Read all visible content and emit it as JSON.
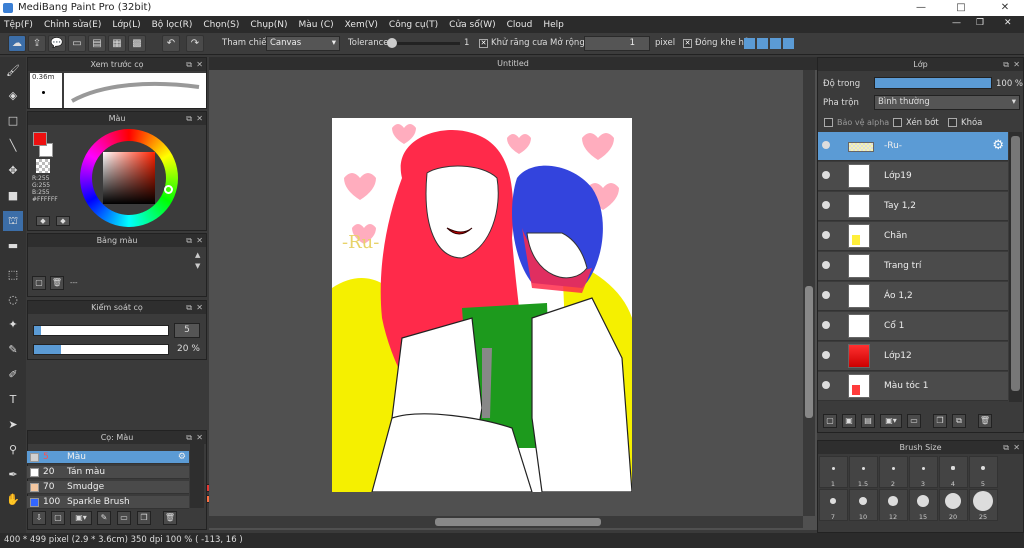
{
  "window": {
    "title": "MediBang Paint Pro (32bit)",
    "min": "—",
    "restore": "□",
    "close": "✕",
    "inner_min": "—",
    "inner_restore": "❐",
    "inner_close": "✕"
  },
  "menu": [
    "Tệp(F)",
    "Chỉnh sửa(E)",
    "Lớp(L)",
    "Bộ lọc(R)",
    "Chọn(S)",
    "Chụp(N)",
    "Màu (C)",
    "Xem(V)",
    "Công cụ(T)",
    "Cửa sổ(W)",
    "Cloud",
    "Help"
  ],
  "toolbar": {
    "ref_label": "Tham chiếu",
    "ref_value": "Canvas",
    "tolerance_label": "Tolerance",
    "tolerance_value": "1",
    "antialias_label": "Khử răng cưa",
    "expand_label": "Mở rộng",
    "expand_value": "1",
    "expand_unit": "pixel",
    "gap_label": "Đóng khe hở"
  },
  "brush_preview": {
    "title": "Xem trước cọ",
    "size": "0.36m"
  },
  "color_panel": {
    "title": "Màu",
    "r": "R:255",
    "g": "G:255",
    "b": "B:255",
    "hex": "#FFFFFF",
    "primary": "#ee1111",
    "secondary": "#ffffff"
  },
  "palette": {
    "title": "Bảng màu",
    "label": "---",
    "row1": [
      "#3b7fd4",
      "#5fb0ff",
      "#7a5cc0",
      "#a0a0a0",
      "#404040",
      "#8b5a2b",
      "#2e7d32",
      "#66bb6a",
      "#cccccc",
      "#9e9e9e",
      "#5d4037",
      "#ff8a80",
      "#ff5252",
      "#ffcdd2",
      "#ffffff",
      "#ffffff",
      "#e53935",
      "#b71c1c"
    ],
    "row2": [
      "#fff59d",
      "#ffe0b2",
      "#ffcc80",
      "#ff8a65",
      "#d81b60",
      "#ba68c8",
      "#90caf9",
      "#a5d6a7",
      "#f8bbd0",
      "#ffab91",
      "#ffffff",
      "#fbe9e7",
      "#eeeeee",
      "#ffffff",
      "#4e342e",
      "#ffffff",
      "#ff7043",
      "#c62828"
    ]
  },
  "brush_control": {
    "title": "Kiểm soát cọ",
    "size_value": "5",
    "opacity_value": "20 %",
    "size_fill": 0.05,
    "opacity_fill": 0.2
  },
  "brushes": {
    "title": "Cọ: Màu",
    "items": [
      {
        "num": "5",
        "name": "Màu",
        "color": "#d0d0d0"
      },
      {
        "num": "20",
        "name": "Tán màu",
        "color": "#ffffff"
      },
      {
        "num": "70",
        "name": "Smudge",
        "color": "#f4c7a1"
      },
      {
        "num": "100",
        "name": "Sparkle Brush",
        "color": "#3366ff"
      }
    ]
  },
  "document": {
    "tab_title": "Untitled",
    "watermark": "-Ru-"
  },
  "layers": {
    "title": "Lớp",
    "opacity_label": "Độ trong",
    "opacity_value": "100 %",
    "opacity_fill": 1.0,
    "blend_label": "Pha trộn",
    "blend_value": "Bình thường",
    "alpha_label": "Bảo vệ alpha",
    "clip_label": "Xén bớt",
    "lock_label": "Khóa",
    "items": [
      "-Ru-",
      "Lớp19",
      "Tay 1,2",
      "Chăn",
      "Trang trí",
      "Áo 1,2",
      "Cổ 1",
      "Lớp12",
      "Màu tóc 1"
    ]
  },
  "brush_size": {
    "title": "Brush Size",
    "row1": [
      "1",
      "1.5",
      "2",
      "3",
      "4",
      "5"
    ],
    "row2": [
      "7",
      "10",
      "12",
      "15",
      "20",
      "25"
    ]
  },
  "status": {
    "text": "400 * 499 pixel   (2.9 * 3.6cm)   350 dpi   100 %   ( -113, 16 )"
  }
}
